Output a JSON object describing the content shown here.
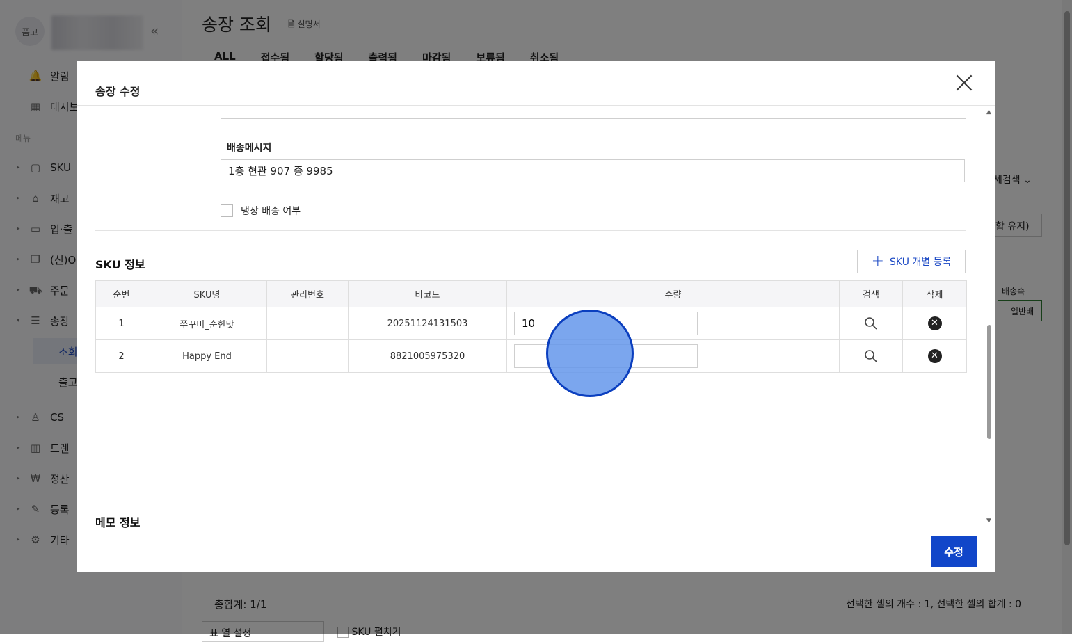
{
  "sidebar": {
    "logo_text": "품고",
    "menu_caption": "메뉴",
    "top_items": [
      {
        "label": "알림",
        "icon": "bell-icon"
      },
      {
        "label": "대시보",
        "icon": "dashboard-icon"
      }
    ],
    "items": [
      {
        "label": "SKU",
        "icon": "bag-icon"
      },
      {
        "label": "재고",
        "icon": "warehouse-icon"
      },
      {
        "label": "입·출",
        "icon": "truck-icon"
      },
      {
        "label": "(신)O",
        "icon": "copy-icon"
      },
      {
        "label": "주문",
        "icon": "cart-icon"
      },
      {
        "label": "송장",
        "icon": "invoice-icon"
      },
      {
        "label": "CS",
        "icon": "user-icon"
      },
      {
        "label": "트렌",
        "icon": "chart-icon"
      },
      {
        "label": "정산",
        "icon": "won-icon"
      },
      {
        "label": "등록",
        "icon": "edit-icon"
      },
      {
        "label": "기타",
        "icon": "gear-icon"
      }
    ],
    "sub_items": [
      {
        "label": "조회",
        "active": true
      },
      {
        "label": "출고",
        "active": false
      }
    ]
  },
  "page": {
    "title": "송장 조회",
    "manual_label": "설명서",
    "tabs": [
      "ALL",
      "접수됨",
      "할당됨",
      "출력됨",
      "마감됨",
      "보류됨",
      "취소됨"
    ],
    "right_search_label": "세검색",
    "right_keep_label": "합 유지)",
    "right_col_header": "배송속",
    "right_cell": "일반배",
    "total_label": "총합계: 1/1",
    "selection_summary": "선택한 셀의 개수 : 1, 선택한 셀의 합계 : 0",
    "column_setting_label": "표 열 설정",
    "sku_toggle_label": "SKU 펼치기"
  },
  "modal": {
    "title": "송장 수정",
    "delivery_message_label": "배송메시지",
    "delivery_message_value": "1층 현관 907 종 9985",
    "cold_delivery_label": "냉장 배송 여부",
    "cold_delivery_checked": false,
    "sku_section_title": "SKU 정보",
    "add_sku_label": "SKU 개별 등록",
    "columns": [
      "순번",
      "SKU명",
      "관리번호",
      "바코드",
      "수량",
      "검색",
      "삭제"
    ],
    "rows": [
      {
        "index": "1",
        "name": "쭈꾸미_순한맛",
        "management_no": "",
        "barcode": "20251124131503",
        "quantity": "10"
      },
      {
        "index": "2",
        "name": "Happy End",
        "management_no": "",
        "barcode": "8821005975320",
        "quantity": ""
      }
    ],
    "memo_section_title": "메모 정보",
    "submit_label": "수정"
  },
  "colors": {
    "primary": "#1146c9",
    "overlay": "rgba(0,0,0,0.5)",
    "tap_indicator": "#6496eb"
  }
}
